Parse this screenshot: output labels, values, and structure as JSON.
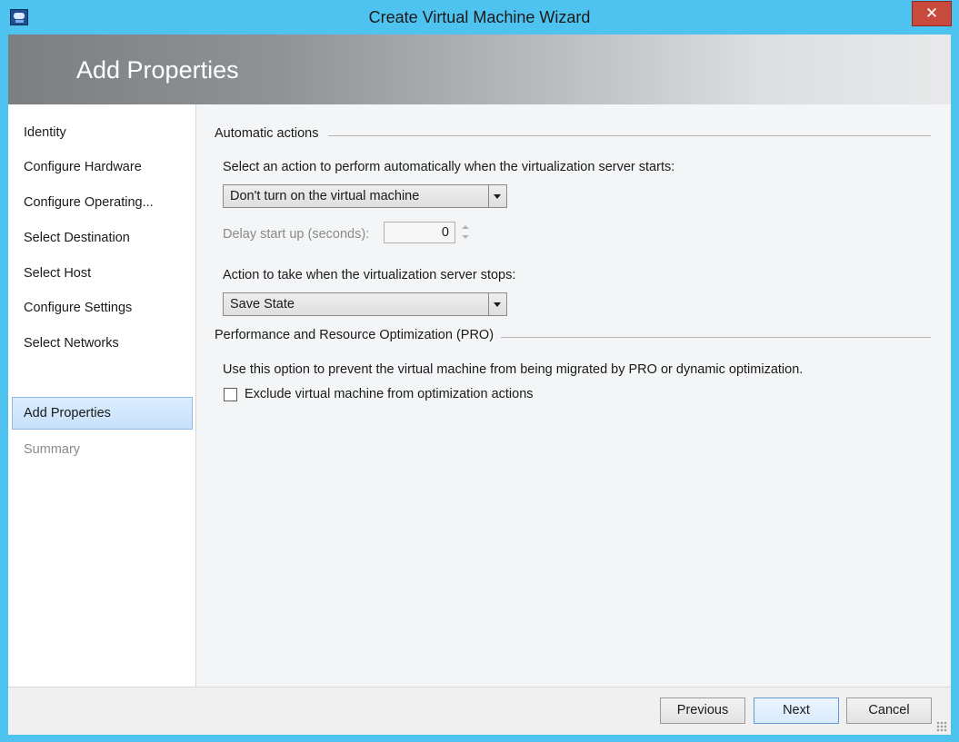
{
  "window": {
    "title": "Create Virtual Machine Wizard",
    "close_glyph": "✕"
  },
  "banner": {
    "title": "Add Properties"
  },
  "nav": {
    "items": [
      {
        "label": "Identity"
      },
      {
        "label": "Configure Hardware"
      },
      {
        "label": "Configure Operating..."
      },
      {
        "label": "Select Destination"
      },
      {
        "label": "Select Host"
      },
      {
        "label": "Configure Settings"
      },
      {
        "label": "Select Networks"
      },
      {
        "label": "Add Properties",
        "selected": true
      },
      {
        "label": "Summary",
        "disabled": true
      }
    ]
  },
  "automatic_actions": {
    "heading": "Automatic actions",
    "start_prompt": "Select an action to perform automatically when the virtualization server starts:",
    "start_action": "Don't turn on the virtual machine",
    "delay_label": "Delay start up (seconds):",
    "delay_value": "0",
    "stop_prompt": "Action to take when the virtualization server stops:",
    "stop_action": "Save State"
  },
  "pro": {
    "heading": "Performance and Resource Optimization (PRO)",
    "description": "Use this option to prevent the virtual machine from being migrated by PRO or dynamic optimization.",
    "exclude_label": "Exclude virtual machine from optimization actions",
    "exclude_checked": false
  },
  "footer": {
    "previous": "Previous",
    "next": "Next",
    "cancel": "Cancel"
  }
}
